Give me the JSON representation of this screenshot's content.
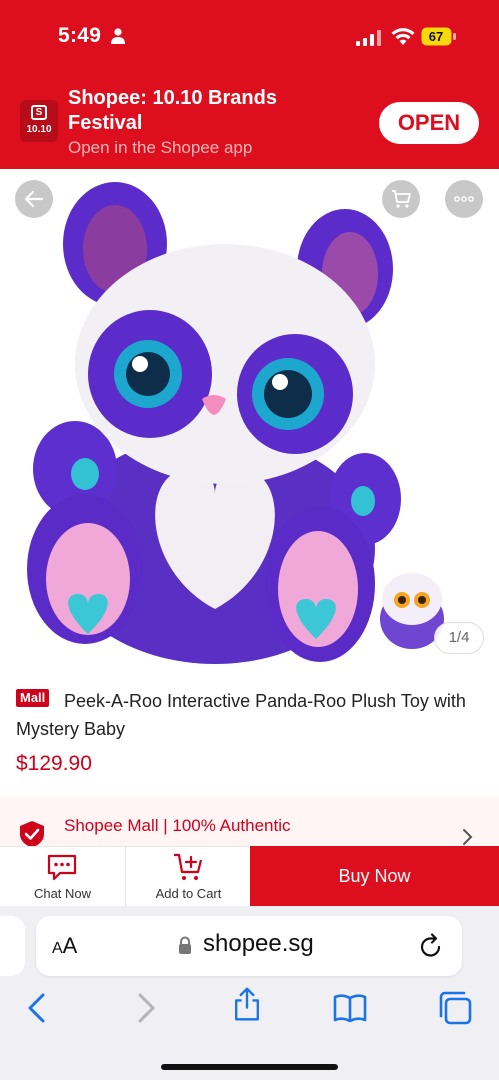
{
  "status_bar": {
    "time": "5:49",
    "battery": "67",
    "battery_color": "#f5d90a"
  },
  "app_banner": {
    "title": "Shopee: 10.10 Brands Festival",
    "subtitle": "Open in the Shopee app",
    "open_label": "OPEN",
    "logo_text": "10.10",
    "logo_mark": "S",
    "brand_color": "#dd0f1f"
  },
  "product": {
    "image_counter": "1/4",
    "mall_badge": "Mall",
    "title": "Peek-A-Roo Interactive Panda-Roo Plush Toy with Mystery Baby",
    "price": "$129.90",
    "price_color": "#d0011b"
  },
  "mall_strip": {
    "text": "Shopee Mall | 100% Authentic"
  },
  "action_bar": {
    "chat_label": "Chat Now",
    "cart_label": "Add to Cart",
    "buy_label": "Buy Now"
  },
  "browser": {
    "text_size_label": "AA",
    "address": "shopee.sg"
  },
  "icons": [
    "person-icon",
    "cellular-signal-icon",
    "wifi-icon",
    "battery-icon",
    "back-arrow-icon",
    "cart-icon",
    "more-icon",
    "shield-check-icon",
    "chevron-right-icon",
    "chat-icon",
    "add-to-cart-icon",
    "lock-icon",
    "reload-icon",
    "back-icon",
    "forward-icon",
    "share-icon",
    "bookmarks-icon",
    "tabs-icon"
  ]
}
